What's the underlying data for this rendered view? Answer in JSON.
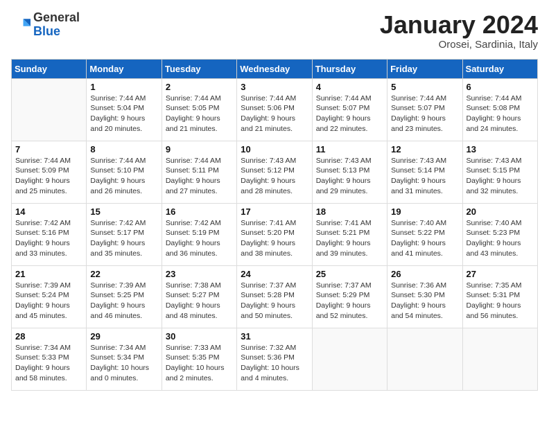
{
  "header": {
    "logo_general": "General",
    "logo_blue": "Blue",
    "title": "January 2024",
    "subtitle": "Orosei, Sardinia, Italy"
  },
  "weekdays": [
    "Sunday",
    "Monday",
    "Tuesday",
    "Wednesday",
    "Thursday",
    "Friday",
    "Saturday"
  ],
  "weeks": [
    [
      {
        "day": "",
        "sunrise": "",
        "sunset": "",
        "daylight": ""
      },
      {
        "day": "1",
        "sunrise": "Sunrise: 7:44 AM",
        "sunset": "Sunset: 5:04 PM",
        "daylight": "Daylight: 9 hours and 20 minutes."
      },
      {
        "day": "2",
        "sunrise": "Sunrise: 7:44 AM",
        "sunset": "Sunset: 5:05 PM",
        "daylight": "Daylight: 9 hours and 21 minutes."
      },
      {
        "day": "3",
        "sunrise": "Sunrise: 7:44 AM",
        "sunset": "Sunset: 5:06 PM",
        "daylight": "Daylight: 9 hours and 21 minutes."
      },
      {
        "day": "4",
        "sunrise": "Sunrise: 7:44 AM",
        "sunset": "Sunset: 5:07 PM",
        "daylight": "Daylight: 9 hours and 22 minutes."
      },
      {
        "day": "5",
        "sunrise": "Sunrise: 7:44 AM",
        "sunset": "Sunset: 5:07 PM",
        "daylight": "Daylight: 9 hours and 23 minutes."
      },
      {
        "day": "6",
        "sunrise": "Sunrise: 7:44 AM",
        "sunset": "Sunset: 5:08 PM",
        "daylight": "Daylight: 9 hours and 24 minutes."
      }
    ],
    [
      {
        "day": "7",
        "sunrise": "Sunrise: 7:44 AM",
        "sunset": "Sunset: 5:09 PM",
        "daylight": "Daylight: 9 hours and 25 minutes."
      },
      {
        "day": "8",
        "sunrise": "Sunrise: 7:44 AM",
        "sunset": "Sunset: 5:10 PM",
        "daylight": "Daylight: 9 hours and 26 minutes."
      },
      {
        "day": "9",
        "sunrise": "Sunrise: 7:44 AM",
        "sunset": "Sunset: 5:11 PM",
        "daylight": "Daylight: 9 hours and 27 minutes."
      },
      {
        "day": "10",
        "sunrise": "Sunrise: 7:43 AM",
        "sunset": "Sunset: 5:12 PM",
        "daylight": "Daylight: 9 hours and 28 minutes."
      },
      {
        "day": "11",
        "sunrise": "Sunrise: 7:43 AM",
        "sunset": "Sunset: 5:13 PM",
        "daylight": "Daylight: 9 hours and 29 minutes."
      },
      {
        "day": "12",
        "sunrise": "Sunrise: 7:43 AM",
        "sunset": "Sunset: 5:14 PM",
        "daylight": "Daylight: 9 hours and 31 minutes."
      },
      {
        "day": "13",
        "sunrise": "Sunrise: 7:43 AM",
        "sunset": "Sunset: 5:15 PM",
        "daylight": "Daylight: 9 hours and 32 minutes."
      }
    ],
    [
      {
        "day": "14",
        "sunrise": "Sunrise: 7:42 AM",
        "sunset": "Sunset: 5:16 PM",
        "daylight": "Daylight: 9 hours and 33 minutes."
      },
      {
        "day": "15",
        "sunrise": "Sunrise: 7:42 AM",
        "sunset": "Sunset: 5:17 PM",
        "daylight": "Daylight: 9 hours and 35 minutes."
      },
      {
        "day": "16",
        "sunrise": "Sunrise: 7:42 AM",
        "sunset": "Sunset: 5:19 PM",
        "daylight": "Daylight: 9 hours and 36 minutes."
      },
      {
        "day": "17",
        "sunrise": "Sunrise: 7:41 AM",
        "sunset": "Sunset: 5:20 PM",
        "daylight": "Daylight: 9 hours and 38 minutes."
      },
      {
        "day": "18",
        "sunrise": "Sunrise: 7:41 AM",
        "sunset": "Sunset: 5:21 PM",
        "daylight": "Daylight: 9 hours and 39 minutes."
      },
      {
        "day": "19",
        "sunrise": "Sunrise: 7:40 AM",
        "sunset": "Sunset: 5:22 PM",
        "daylight": "Daylight: 9 hours and 41 minutes."
      },
      {
        "day": "20",
        "sunrise": "Sunrise: 7:40 AM",
        "sunset": "Sunset: 5:23 PM",
        "daylight": "Daylight: 9 hours and 43 minutes."
      }
    ],
    [
      {
        "day": "21",
        "sunrise": "Sunrise: 7:39 AM",
        "sunset": "Sunset: 5:24 PM",
        "daylight": "Daylight: 9 hours and 45 minutes."
      },
      {
        "day": "22",
        "sunrise": "Sunrise: 7:39 AM",
        "sunset": "Sunset: 5:25 PM",
        "daylight": "Daylight: 9 hours and 46 minutes."
      },
      {
        "day": "23",
        "sunrise": "Sunrise: 7:38 AM",
        "sunset": "Sunset: 5:27 PM",
        "daylight": "Daylight: 9 hours and 48 minutes."
      },
      {
        "day": "24",
        "sunrise": "Sunrise: 7:37 AM",
        "sunset": "Sunset: 5:28 PM",
        "daylight": "Daylight: 9 hours and 50 minutes."
      },
      {
        "day": "25",
        "sunrise": "Sunrise: 7:37 AM",
        "sunset": "Sunset: 5:29 PM",
        "daylight": "Daylight: 9 hours and 52 minutes."
      },
      {
        "day": "26",
        "sunrise": "Sunrise: 7:36 AM",
        "sunset": "Sunset: 5:30 PM",
        "daylight": "Daylight: 9 hours and 54 minutes."
      },
      {
        "day": "27",
        "sunrise": "Sunrise: 7:35 AM",
        "sunset": "Sunset: 5:31 PM",
        "daylight": "Daylight: 9 hours and 56 minutes."
      }
    ],
    [
      {
        "day": "28",
        "sunrise": "Sunrise: 7:34 AM",
        "sunset": "Sunset: 5:33 PM",
        "daylight": "Daylight: 9 hours and 58 minutes."
      },
      {
        "day": "29",
        "sunrise": "Sunrise: 7:34 AM",
        "sunset": "Sunset: 5:34 PM",
        "daylight": "Daylight: 10 hours and 0 minutes."
      },
      {
        "day": "30",
        "sunrise": "Sunrise: 7:33 AM",
        "sunset": "Sunset: 5:35 PM",
        "daylight": "Daylight: 10 hours and 2 minutes."
      },
      {
        "day": "31",
        "sunrise": "Sunrise: 7:32 AM",
        "sunset": "Sunset: 5:36 PM",
        "daylight": "Daylight: 10 hours and 4 minutes."
      },
      {
        "day": "",
        "sunrise": "",
        "sunset": "",
        "daylight": ""
      },
      {
        "day": "",
        "sunrise": "",
        "sunset": "",
        "daylight": ""
      },
      {
        "day": "",
        "sunrise": "",
        "sunset": "",
        "daylight": ""
      }
    ]
  ]
}
